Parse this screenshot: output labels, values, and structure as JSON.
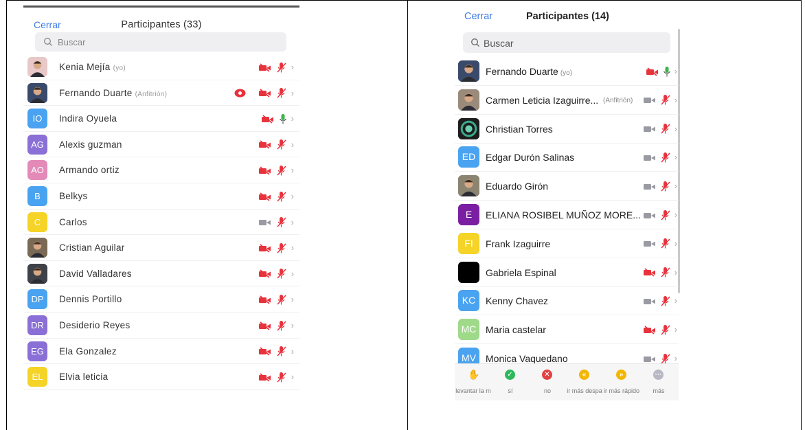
{
  "left": {
    "close_label": "Cerrar",
    "title": "Participantes (33)",
    "search_placeholder": "Buscar",
    "participants": [
      {
        "name": "Kenia Mejía",
        "tag": "(yo)",
        "initials": "",
        "avatar_color": "#e8c8c8",
        "photo": true,
        "video": "off",
        "mic": "muted",
        "host_badge": false
      },
      {
        "name": "Fernando Duarte",
        "tag": "(Anfitrión)",
        "initials": "",
        "avatar_color": "#3a4a6a",
        "photo": true,
        "video": "off",
        "mic": "muted",
        "host_badge": true
      },
      {
        "name": "Indira Oyuela",
        "tag": "",
        "initials": "IO",
        "avatar_color": "#4aa3f0",
        "photo": false,
        "video": "off",
        "mic": "on",
        "host_badge": false
      },
      {
        "name": "Alexis guzman",
        "tag": "",
        "initials": "AG",
        "avatar_color": "#8a6fd6",
        "photo": false,
        "video": "off",
        "mic": "muted",
        "host_badge": false
      },
      {
        "name": "Armando ortiz",
        "tag": "",
        "initials": "AO",
        "avatar_color": "#e38ab8",
        "photo": false,
        "video": "off",
        "mic": "muted",
        "host_badge": false
      },
      {
        "name": "Belkys",
        "tag": "",
        "initials": "B",
        "avatar_color": "#4aa3f0",
        "photo": false,
        "video": "off",
        "mic": "muted",
        "host_badge": false
      },
      {
        "name": "Carlos",
        "tag": "",
        "initials": "C",
        "avatar_color": "#f5d327",
        "photo": false,
        "video": "gray",
        "mic": "muted",
        "host_badge": false
      },
      {
        "name": "Cristian Aguilar",
        "tag": "",
        "initials": "",
        "avatar_color": "#7a6a55",
        "photo": true,
        "video": "off",
        "mic": "muted",
        "host_badge": false
      },
      {
        "name": "David Valladares",
        "tag": "",
        "initials": "",
        "avatar_color": "#3e4148",
        "photo": true,
        "video": "off",
        "mic": "muted",
        "host_badge": false
      },
      {
        "name": "Dennis Portillo",
        "tag": "",
        "initials": "DP",
        "avatar_color": "#4aa3f0",
        "photo": false,
        "video": "off",
        "mic": "muted",
        "host_badge": false
      },
      {
        "name": "Desiderio Reyes",
        "tag": "",
        "initials": "DR",
        "avatar_color": "#8a6fd6",
        "photo": false,
        "video": "off",
        "mic": "muted",
        "host_badge": false
      },
      {
        "name": "Ela Gonzalez",
        "tag": "",
        "initials": "EG",
        "avatar_color": "#8a6fd6",
        "photo": false,
        "video": "off",
        "mic": "muted",
        "host_badge": false
      },
      {
        "name": "Elvia leticia",
        "tag": "",
        "initials": "EL",
        "avatar_color": "#f5d327",
        "photo": false,
        "video": "off",
        "mic": "muted",
        "host_badge": false
      }
    ]
  },
  "right": {
    "close_label": "Cerrar",
    "title": "Participantes (14)",
    "search_placeholder": "Buscar",
    "participants": [
      {
        "name": "Fernando Duarte",
        "tag": "(yo)",
        "tag_right": "",
        "initials": "",
        "avatar_color": "#3a4a6a",
        "photo": true,
        "video": "off",
        "mic": "on"
      },
      {
        "name": "Carmen Leticia Izaguirre...",
        "tag": "",
        "tag_right": "(Anfitrión)",
        "initials": "",
        "avatar_color": "#9a8a7a",
        "photo": true,
        "video": "gray",
        "mic": "muted"
      },
      {
        "name": "Christian Torres",
        "tag": "",
        "tag_right": "",
        "initials": "",
        "avatar_color": "#1c1c1c",
        "photo": true,
        "video": "gray",
        "mic": "muted"
      },
      {
        "name": "Edgar Durón Salinas",
        "tag": "",
        "tag_right": "",
        "initials": "ED",
        "avatar_color": "#4aa3f0",
        "photo": false,
        "video": "gray",
        "mic": "muted"
      },
      {
        "name": "Eduardo Girón",
        "tag": "",
        "tag_right": "",
        "initials": "",
        "avatar_color": "#8a8470",
        "photo": true,
        "video": "gray",
        "mic": "muted"
      },
      {
        "name": "ELIANA ROSIBEL MUÑOZ MORE...",
        "tag": "",
        "tag_right": "",
        "initials": "E",
        "avatar_color": "#7a1fa2",
        "photo": false,
        "video": "gray",
        "mic": "muted"
      },
      {
        "name": "Frank Izaguirre",
        "tag": "",
        "tag_right": "",
        "initials": "FI",
        "avatar_color": "#f5d327",
        "photo": false,
        "video": "gray",
        "mic": "muted"
      },
      {
        "name": "Gabriela Espinal",
        "tag": "",
        "tag_right": "",
        "initials": "",
        "avatar_color": "#000000",
        "photo": true,
        "video": "off",
        "mic": "muted"
      },
      {
        "name": "Kenny Chavez",
        "tag": "",
        "tag_right": "",
        "initials": "KC",
        "avatar_color": "#4aa3f0",
        "photo": false,
        "video": "gray",
        "mic": "muted"
      },
      {
        "name": "Maria castelar",
        "tag": "",
        "tag_right": "",
        "initials": "MC",
        "avatar_color": "#9fd98a",
        "photo": false,
        "video": "off",
        "mic": "muted"
      },
      {
        "name": "Monica Vaquedano",
        "tag": "",
        "tag_right": "",
        "initials": "MV",
        "avatar_color": "#4aa3f0",
        "photo": false,
        "video": "gray",
        "mic": "muted"
      }
    ],
    "actions": [
      {
        "label": "levantar la m",
        "icon": "raise-hand-icon",
        "color": "#2f6fd9"
      },
      {
        "label": "sí",
        "icon": "check-icon",
        "color": "#2eb85c"
      },
      {
        "label": "no",
        "icon": "x-icon",
        "color": "#e04343"
      },
      {
        "label": "ir más despa",
        "icon": "rewind-icon",
        "color": "#f2b705"
      },
      {
        "label": "ir más rápido",
        "icon": "fast-forward-icon",
        "color": "#f2b705"
      },
      {
        "label": "más",
        "icon": "more-icon",
        "color": "#b8b8c4"
      }
    ]
  }
}
